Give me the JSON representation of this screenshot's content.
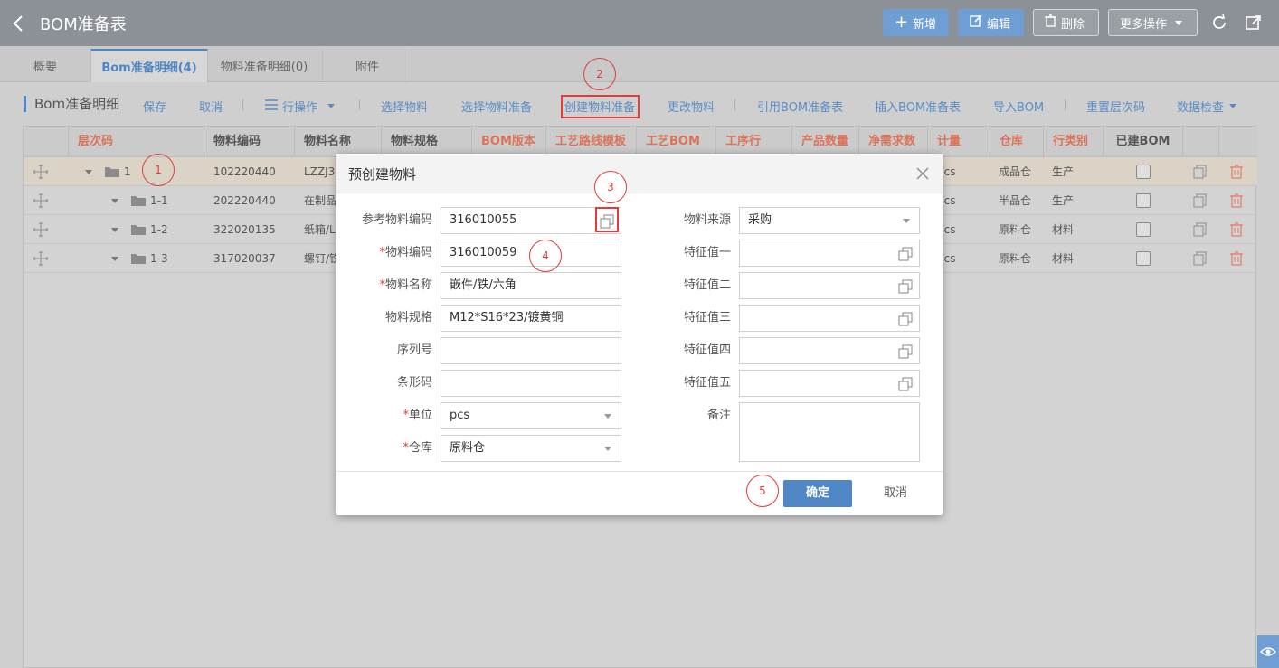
{
  "header": {
    "title": "BOM准备表",
    "actions": {
      "new": "新增",
      "edit": "编辑",
      "delete": "删除",
      "more": "更多操作"
    }
  },
  "tabs": [
    {
      "label": "概要"
    },
    {
      "label": "Bom准备明细(4)"
    },
    {
      "label": "物料准备明细(0)"
    },
    {
      "label": "附件"
    }
  ],
  "toolbar": {
    "title": "Bom准备明细",
    "save": "保存",
    "cancel": "取消",
    "row_ops": "行操作",
    "select_material": "选择物料",
    "select_material_prep": "选择物料准备",
    "create_material_prep": "创建物料准备",
    "change_material": "更改物料",
    "ref_bom": "引用BOM准备表",
    "insert_bom": "插入BOM准备表",
    "import_bom": "导入BOM",
    "reset_level": "重置层次码",
    "data_check": "数据检查"
  },
  "table": {
    "columns": [
      "层次码",
      "物料编码",
      "物料名称",
      "物料规格",
      "BOM版本",
      "工艺路线模板",
      "工艺BOM",
      "工序行",
      "产品数量",
      "净需求数",
      "计量",
      "仓库",
      "行类别",
      "已建BOM"
    ],
    "rows": [
      {
        "level": "1",
        "code": "102220440",
        "name": "LZZJ3",
        "unit": "pcs",
        "warehouse": "成品仓",
        "category": "生产"
      },
      {
        "level": "1-1",
        "code": "202220440",
        "name": "在制品",
        "unit": "pcs",
        "warehouse": "半品仓",
        "category": "生产"
      },
      {
        "level": "1-2",
        "code": "322020135",
        "name": "纸箱/L",
        "unit": "pcs",
        "warehouse": "原料仓",
        "category": "材料"
      },
      {
        "level": "1-3",
        "code": "317020037",
        "name": "螺钉/铁",
        "unit": "pcs",
        "warehouse": "原料仓",
        "category": "材料"
      }
    ]
  },
  "dialog": {
    "title": "预创建物料",
    "left": [
      {
        "label": "参考物料编码",
        "required": false,
        "value": "316010055"
      },
      {
        "label": "物料编码",
        "required": true,
        "value": "316010059"
      },
      {
        "label": "物料名称",
        "required": true,
        "value": "嵌件/铁/六角"
      },
      {
        "label": "物料规格",
        "required": false,
        "value": "M12*S16*23/镀黄铜"
      },
      {
        "label": "序列号",
        "required": false,
        "value": ""
      },
      {
        "label": "条形码",
        "required": false,
        "value": ""
      },
      {
        "label": "单位",
        "required": true,
        "value": "pcs"
      },
      {
        "label": "仓库",
        "required": true,
        "value": "原料仓"
      }
    ],
    "right": [
      {
        "label": "物料来源",
        "value": "采购"
      },
      {
        "label": "特征值一",
        "value": ""
      },
      {
        "label": "特征值二",
        "value": ""
      },
      {
        "label": "特征值三",
        "value": ""
      },
      {
        "label": "特征值四",
        "value": ""
      },
      {
        "label": "特征值五",
        "value": ""
      },
      {
        "label": "备注",
        "value": ""
      }
    ],
    "ok": "确定",
    "cancel": "取消"
  },
  "steps": [
    "1",
    "2",
    "3",
    "4",
    "5"
  ],
  "colors": {
    "accent": "#4f86c6",
    "danger": "#e23b3b",
    "header_bg": "#8c9097"
  }
}
